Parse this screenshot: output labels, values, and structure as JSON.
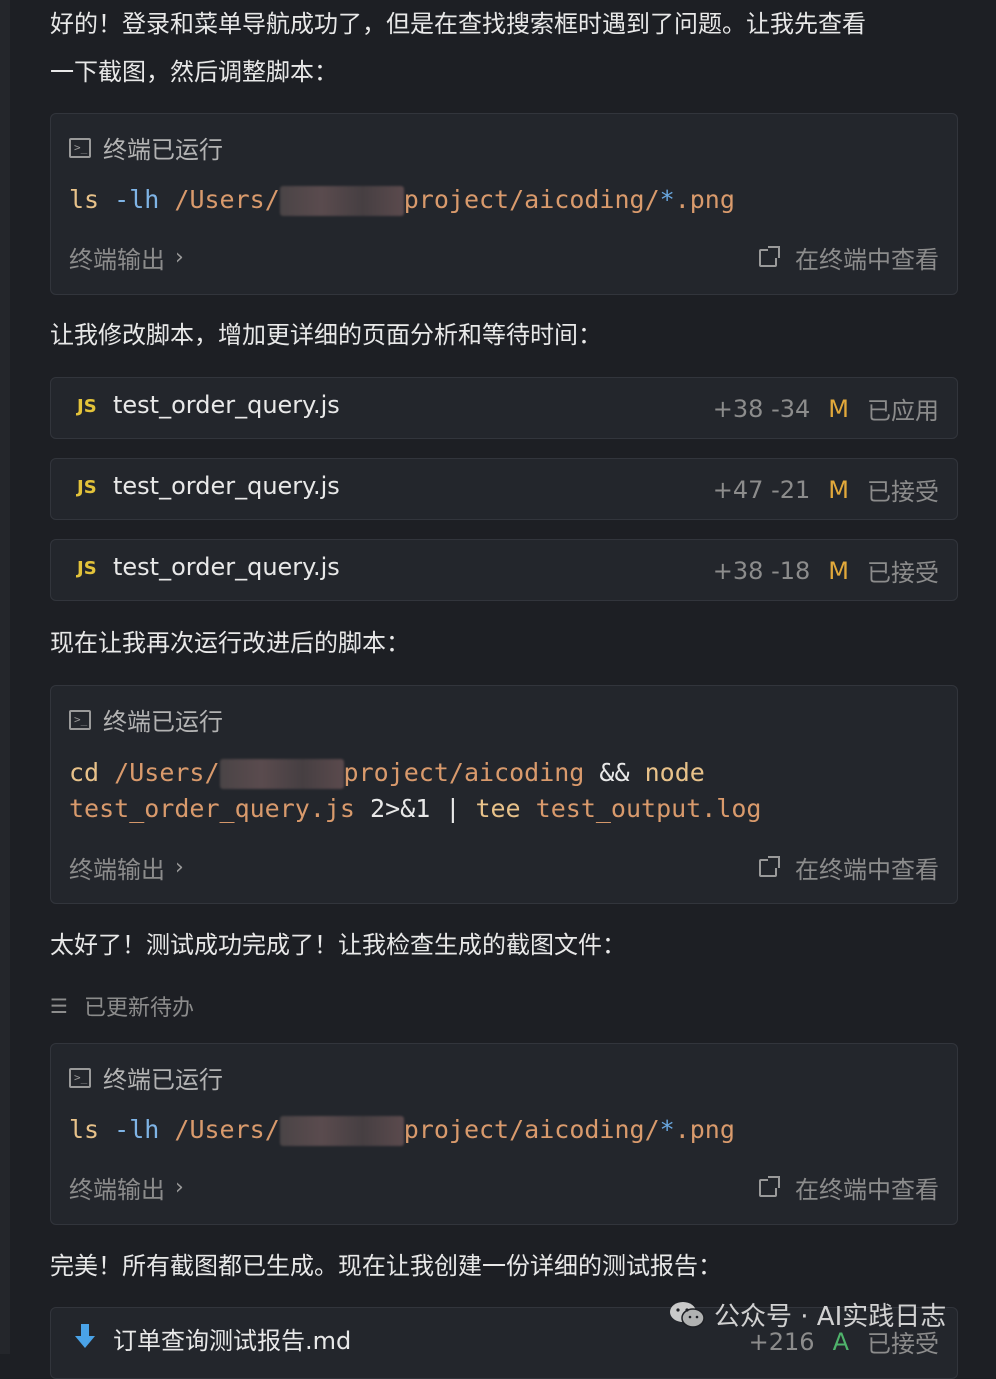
{
  "messages": {
    "m1_line1": "好的！登录和菜单导航成功了，但是在查找搜索框时遇到了问题。让我先查看",
    "m1_line2": "一下截图，然后调整脚本：",
    "m2": "让我修改脚本，增加更详细的页面分析和等待时间：",
    "m3": "现在让我再次运行改进后的脚本：",
    "m4": "太好了！测试成功完成了！让我检查生成的截图文件：",
    "m5": "完美！所有截图都已生成。现在让我创建一份详细的测试报告："
  },
  "terminal_cards": [
    {
      "header": "终端已运行",
      "cmd1": "ls",
      "flag1": "-lh",
      "path1a": "/Users/",
      "path1b": "project/aicoding/",
      "star": "*",
      "ext": ".png",
      "output_label": "终端输出",
      "view_label": "在终端中查看"
    },
    {
      "header": "终端已运行",
      "cmd1": "cd",
      "path1a": "/Users/",
      "path1b": "project/aicoding",
      "op1": "&&",
      "cmd2": "node",
      "line2_file": "test_order_query.js",
      "op2": "2>&1",
      "op3": "|",
      "cmd3": "tee",
      "line2_log": "test_output.log",
      "output_label": "终端输出",
      "view_label": "在终端中查看"
    },
    {
      "header": "终端已运行",
      "cmd1": "ls",
      "flag1": "-lh",
      "path1a": "/Users/",
      "path1b": "project/aicoding/",
      "star": "*",
      "ext": ".png",
      "output_label": "终端输出",
      "view_label": "在终端中查看"
    }
  ],
  "files": [
    {
      "badge": "JS",
      "name": "test_order_query.js",
      "diff": "+38 -34",
      "mark": "M",
      "status": "已应用"
    },
    {
      "badge": "JS",
      "name": "test_order_query.js",
      "diff": "+47 -21",
      "mark": "M",
      "status": "已接受"
    },
    {
      "badge": "JS",
      "name": "test_order_query.js",
      "diff": "+38 -18",
      "mark": "M",
      "status": "已接受"
    },
    {
      "badge": "",
      "name": "订单查询测试报告.md",
      "diff": "+216",
      "mark": "A",
      "status": "已接受"
    }
  ],
  "todo": {
    "label": "已更新待办"
  },
  "watermark": {
    "text": "公众号 · AI实践日志"
  },
  "icons": {
    "terminal": "terminal-icon",
    "external": "external-link-icon",
    "chevron": "chevron-right-icon",
    "list": "list-icon",
    "markdown": "markdown-file-icon",
    "wechat": "wechat-icon"
  },
  "colors": {
    "background": "#1d1f24",
    "card": "#23262c",
    "modified": "#e2a93b",
    "added": "#4fb36b",
    "js_badge": "#e3c33a"
  }
}
